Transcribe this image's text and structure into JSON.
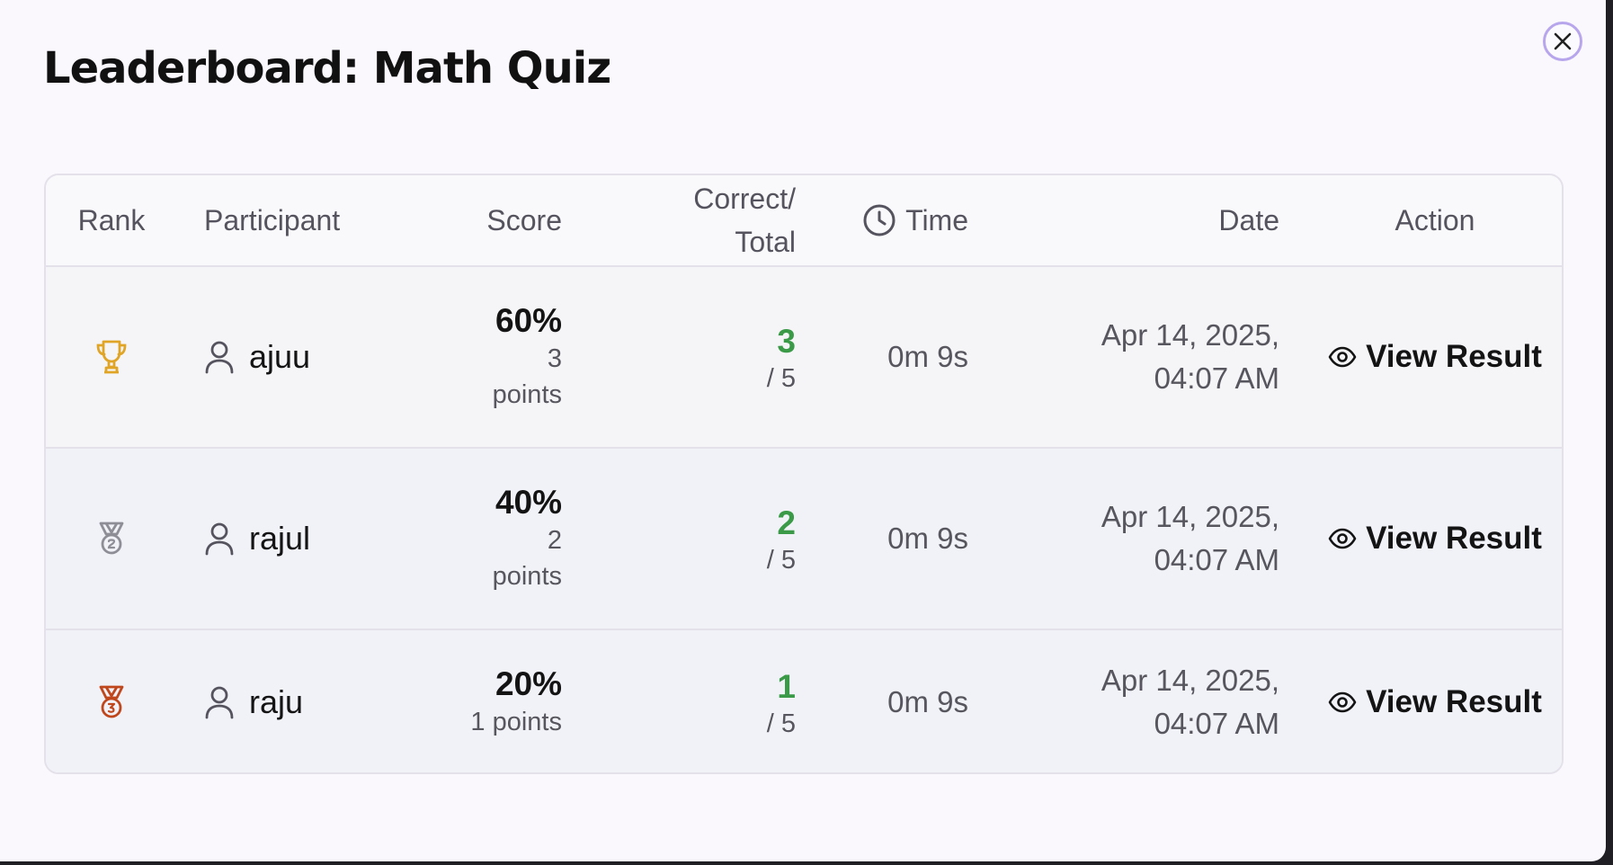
{
  "modal": {
    "title": "Leaderboard: Math Quiz",
    "close_icon": "close-icon"
  },
  "table": {
    "headers": {
      "rank": "Rank",
      "participant": "Participant",
      "score": "Score",
      "correct_line1": "Correct/",
      "correct_line2": "Total",
      "time": "Time",
      "date": "Date",
      "action": "Action"
    },
    "rows": [
      {
        "rank_icon": "trophy-icon",
        "participant": "ajuu",
        "score_percent": "60%",
        "points_line1": "3",
        "points_line2": "points",
        "correct": "3",
        "total": "/ 5",
        "time": "0m 9s",
        "date_line1": "Apr 14, 2025,",
        "date_line2": "04:07 AM",
        "action": "View Result"
      },
      {
        "rank_icon": "silver-medal-icon",
        "participant": "rajul",
        "score_percent": "40%",
        "points_line1": "2",
        "points_line2": "points",
        "correct": "2",
        "total": "/ 5",
        "time": "0m 9s",
        "date_line1": "Apr 14, 2025,",
        "date_line2": "04:07 AM",
        "action": "View Result"
      },
      {
        "rank_icon": "bronze-medal-icon",
        "participant": "raju",
        "score_percent": "20%",
        "points": "1 points",
        "correct": "1",
        "total": "/ 5",
        "time": "0m 9s",
        "date_line1": "Apr 14, 2025,",
        "date_line2": "04:07 AM",
        "action": "View Result"
      }
    ]
  },
  "colors": {
    "gold": "#e0a526",
    "silver": "#8e8e96",
    "bronze": "#c0461c",
    "correct_green": "#3a9a47",
    "close_ring": "#b7a6ec"
  }
}
